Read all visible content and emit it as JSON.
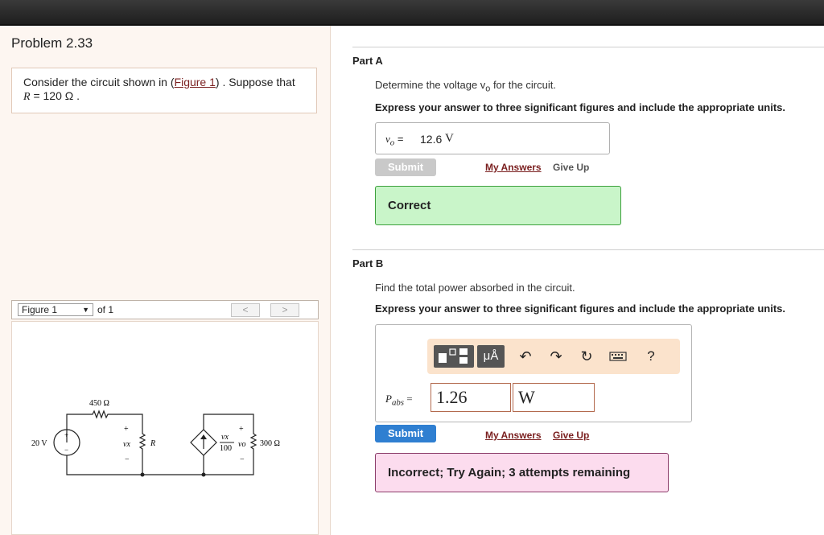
{
  "problem": {
    "title": "Problem 2.33",
    "intro_before_link": "Consider the circuit shown in (",
    "intro_link": "Figure 1",
    "intro_after_link": ") . Suppose that",
    "intro_line2_var": "R",
    "intro_line2_value": " = 120  Ω ."
  },
  "figure_nav": {
    "selected": "Figure 1",
    "of_text": "of 1",
    "prev_label": "<",
    "next_label": ">"
  },
  "circuit": {
    "r450": "450 Ω",
    "source_v": "20 V",
    "plus": "+",
    "minus": "−",
    "vx": "vx",
    "r_label": "R",
    "frac_num": "vx",
    "frac_den": "100",
    "vo": "vo",
    "r300": "300 Ω"
  },
  "part_a": {
    "label": "Part A",
    "question": "Determine the voltage v",
    "question_sub": "o",
    "question_end": " for the circuit.",
    "instruction": "Express your answer to three significant figures and include the appropriate units.",
    "var_label": "v",
    "var_sub": "o",
    "equals": " =",
    "answer_num": "12.6",
    "answer_unit": "V",
    "submit": "Submit",
    "my_answers": "My Answers",
    "give_up": "Give Up",
    "feedback": "Correct"
  },
  "part_b": {
    "label": "Part B",
    "question": "Find the total power absorbed in the circuit.",
    "instruction": "Express your answer to three significant figures and include the appropriate units.",
    "toolbar_units": "μÅ",
    "toolbar_help": "?",
    "var_label": "P",
    "var_sub": "abs",
    "equals": " =",
    "value": "1.26",
    "unit": "W",
    "submit": "Submit",
    "my_answers": "My Answers",
    "give_up": "Give Up",
    "feedback": "Incorrect; Try Again; 3 attempts remaining"
  },
  "colors": {
    "submit_active": "#2f7fd1",
    "submit_disabled": "#c9c9c9",
    "correct_bg": "#c9f5c9",
    "incorrect_bg": "#fcdcee",
    "link": "#7a1f1f"
  }
}
